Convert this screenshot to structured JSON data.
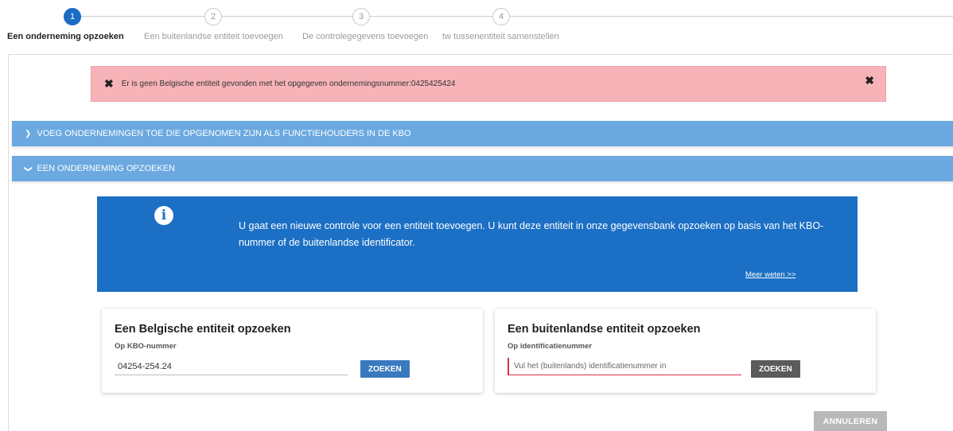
{
  "stepper": {
    "steps": [
      {
        "number": "1",
        "label": "Een onderneming opzoeken",
        "active": true
      },
      {
        "number": "2",
        "label": "Een buitenlandse entiteit toevoegen",
        "active": false
      },
      {
        "number": "3",
        "label": "De controlegegevens toevoegen",
        "active": false
      },
      {
        "number": "4",
        "label": "tw tussenentiteit samenstellen",
        "active": false
      }
    ]
  },
  "alert": {
    "message": "Er is geen Belgische entiteit gevonden met het opgegeven ondernemingsnummer:0425425424",
    "icon": "x-icon",
    "close_icon": "close-icon",
    "color": "#f6b3b8"
  },
  "accordions": [
    {
      "label": "VOEG ONDERNEMINGEN TOE DIE OPGENOMEN ZIJN ALS FUNCTIEHOUDERS IN DE KBO",
      "icon": "chevron-right-icon",
      "expanded": false
    },
    {
      "label": "EEN ONDERNEMING OPZOEKEN",
      "icon": "chevron-down-icon",
      "expanded": true
    }
  ],
  "info": {
    "icon": "info-icon",
    "text": "U gaat een nieuwe controle voor een entiteit toevoegen. U kunt deze entiteit in onze gegevensbank opzoeken op basis van het KBO-nummer of de buitenlandse identificator.",
    "more_link": "Meer weten >>",
    "color": "#1b6fc4"
  },
  "belgian_card": {
    "title": "Een Belgische entiteit opzoeken",
    "subtitle": "Op KBO-nummer",
    "input_value": "04254-254.24",
    "button": "ZOEKEN"
  },
  "foreign_card": {
    "title": "Een buitenlandse entiteit opzoeken",
    "subtitle": "Op identificatienummer",
    "placeholder": "Vul het (buitenlands) identificatienummer in",
    "button": "ZOEKEN"
  },
  "cancel_button": "ANNULEREN"
}
